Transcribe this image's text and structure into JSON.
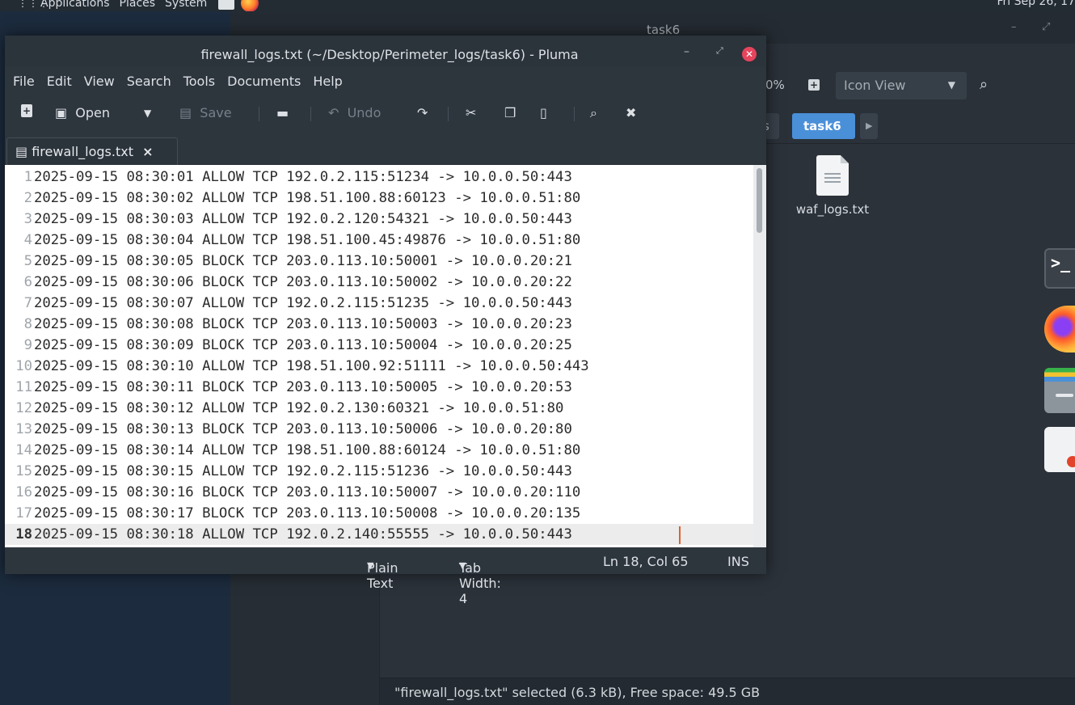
{
  "top_panel": {
    "applications": "Applications",
    "places": "Places",
    "system": "System",
    "clock": "Fri Sep 26, 17"
  },
  "file_manager": {
    "title": "task6",
    "zoom": "0%",
    "view_mode": "Icon View",
    "breadcrumb_prev": "s",
    "breadcrumb_current": "task6",
    "files": [
      {
        "name": "waf_logs.txt"
      }
    ],
    "status": "\"firewall_logs.txt\" selected (6.3 kB), Free space: 49.5 GB"
  },
  "pluma": {
    "title": "firewall_logs.txt (~/Desktop/Perimeter_logs/task6) - Pluma",
    "menu": [
      "File",
      "Edit",
      "View",
      "Search",
      "Tools",
      "Documents",
      "Help"
    ],
    "toolbar": {
      "open": "Open",
      "save": "Save",
      "undo": "Undo"
    },
    "tab": "firewall_logs.txt",
    "lines": [
      {
        "n": "1",
        "text": "2025-09-15 08:30:01 ALLOW TCP 192.0.2.115:51234 -> 10.0.0.50:443"
      },
      {
        "n": "2",
        "text": "2025-09-15 08:30:02 ALLOW TCP 198.51.100.88:60123 -> 10.0.0.51:80"
      },
      {
        "n": "3",
        "text": "2025-09-15 08:30:03 ALLOW TCP 192.0.2.120:54321 -> 10.0.0.50:443"
      },
      {
        "n": "4",
        "text": "2025-09-15 08:30:04 ALLOW TCP 198.51.100.45:49876 -> 10.0.0.51:80"
      },
      {
        "n": "5",
        "text": "2025-09-15 08:30:05 BLOCK TCP 203.0.113.10:50001 -> 10.0.0.20:21"
      },
      {
        "n": "6",
        "text": "2025-09-15 08:30:06 BLOCK TCP 203.0.113.10:50002 -> 10.0.0.20:22"
      },
      {
        "n": "7",
        "text": "2025-09-15 08:30:07 ALLOW TCP 192.0.2.115:51235 -> 10.0.0.50:443"
      },
      {
        "n": "8",
        "text": "2025-09-15 08:30:08 BLOCK TCP 203.0.113.10:50003 -> 10.0.0.20:23"
      },
      {
        "n": "9",
        "text": "2025-09-15 08:30:09 BLOCK TCP 203.0.113.10:50004 -> 10.0.0.20:25"
      },
      {
        "n": "10",
        "text": "2025-09-15 08:30:10 ALLOW TCP 198.51.100.92:51111 -> 10.0.0.50:443"
      },
      {
        "n": "11",
        "text": "2025-09-15 08:30:11 BLOCK TCP 203.0.113.10:50005 -> 10.0.0.20:53"
      },
      {
        "n": "12",
        "text": "2025-09-15 08:30:12 ALLOW TCP 192.0.2.130:60321 -> 10.0.0.51:80"
      },
      {
        "n": "13",
        "text": "2025-09-15 08:30:13 BLOCK TCP 203.0.113.10:50006 -> 10.0.0.20:80"
      },
      {
        "n": "14",
        "text": "2025-09-15 08:30:14 ALLOW TCP 198.51.100.88:60124 -> 10.0.0.51:80"
      },
      {
        "n": "15",
        "text": "2025-09-15 08:30:15 ALLOW TCP 192.0.2.115:51236 -> 10.0.0.50:443"
      },
      {
        "n": "16",
        "text": "2025-09-15 08:30:16 BLOCK TCP 203.0.113.10:50007 -> 10.0.0.20:110"
      },
      {
        "n": "17",
        "text": "2025-09-15 08:30:17 BLOCK TCP 203.0.113.10:50008 -> 10.0.0.20:135"
      },
      {
        "n": "18",
        "text": "2025-09-15 08:30:18 ALLOW TCP 192.0.2.140:55555 -> 10.0.0.50:443"
      }
    ],
    "statusbar": {
      "language": "Plain Text",
      "tab_width": "Tab Width:  4",
      "position": "Ln 18, Col 65",
      "mode": "INS"
    }
  },
  "colors": {
    "accent": "#4a90d9",
    "close_button": "#e6445d",
    "caret": "#e0622a"
  }
}
